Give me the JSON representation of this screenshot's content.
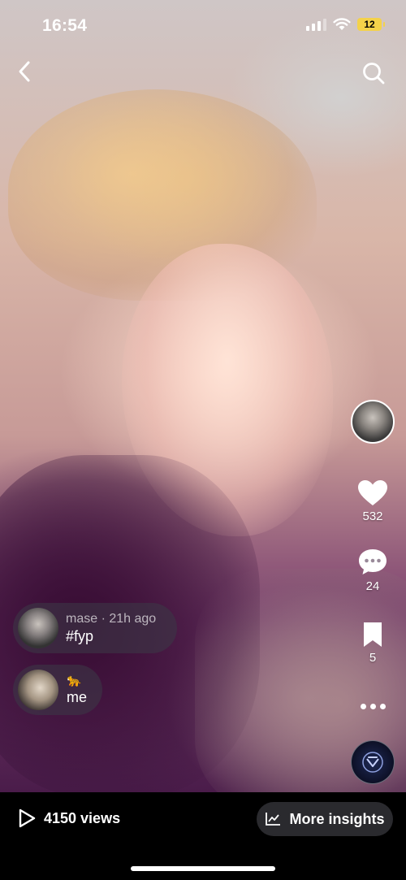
{
  "status_bar": {
    "time": "16:54",
    "battery": "12"
  },
  "post": {
    "creator": "mase",
    "posted_ago": "21h ago",
    "meta_text": "mase · 21h ago",
    "caption": "#fyp"
  },
  "sound": {
    "emoji": "🐆",
    "title": "me"
  },
  "actions": {
    "likes": "532",
    "comments": "24",
    "saves": "5"
  },
  "bottom": {
    "views": "4150 views",
    "insights_label": "More insights"
  },
  "icons": {
    "back": "chevron-left-icon",
    "search": "search-icon",
    "like": "heart-icon",
    "comment": "comment-bubble-icon",
    "save": "bookmark-icon",
    "more": "more-dots-icon",
    "play": "play-icon",
    "insights": "chart-icon"
  },
  "colors": {
    "battery": "#f4d24a",
    "pill_bg": "rgba(60,55,70,0.6)",
    "insights_bg": "#2a2a2e"
  }
}
